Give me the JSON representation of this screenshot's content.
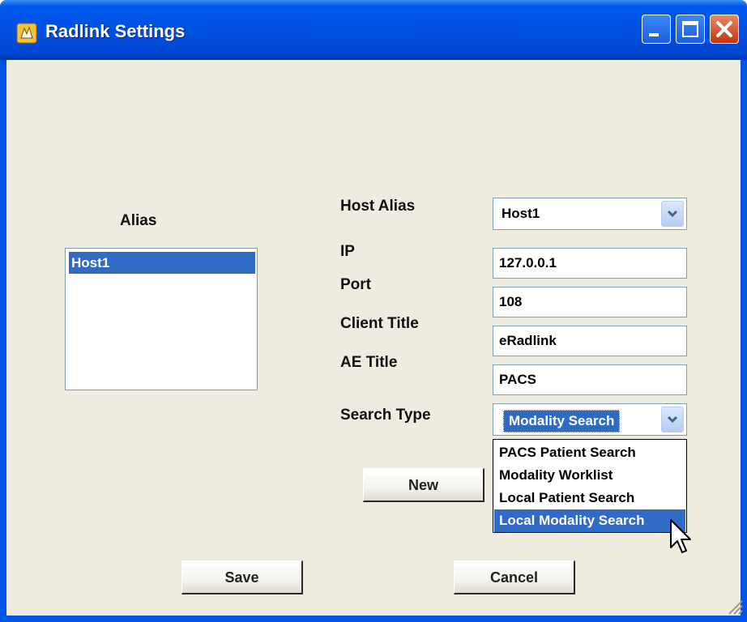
{
  "window": {
    "title": "Radlink Settings",
    "controls": [
      "minimize",
      "maximize",
      "close"
    ]
  },
  "alias_panel": {
    "label": "Alias",
    "items": [
      "Host1"
    ],
    "selected": "Host1"
  },
  "form": {
    "host_alias": {
      "label": "Host Alias",
      "value": "Host1"
    },
    "ip": {
      "label": "IP",
      "value": "127.0.0.1"
    },
    "port": {
      "label": "Port",
      "value": "108"
    },
    "client_title": {
      "label": "Client Title",
      "value": "eRadlink"
    },
    "ae_title": {
      "label": "AE Title",
      "value": "PACS"
    },
    "search_type": {
      "label": "Search Type",
      "value": "Modality Search",
      "options": [
        "PACS Patient Search",
        "Modality Worklist",
        "Local Patient Search",
        "Local Modality Search"
      ],
      "highlighted": "Local Modality Search"
    }
  },
  "buttons": {
    "new": "New",
    "save": "Save",
    "cancel": "Cancel"
  },
  "colors": {
    "title_bar": "#0054e3",
    "window_bg": "#eeebdf",
    "selection": "#316ac5"
  }
}
